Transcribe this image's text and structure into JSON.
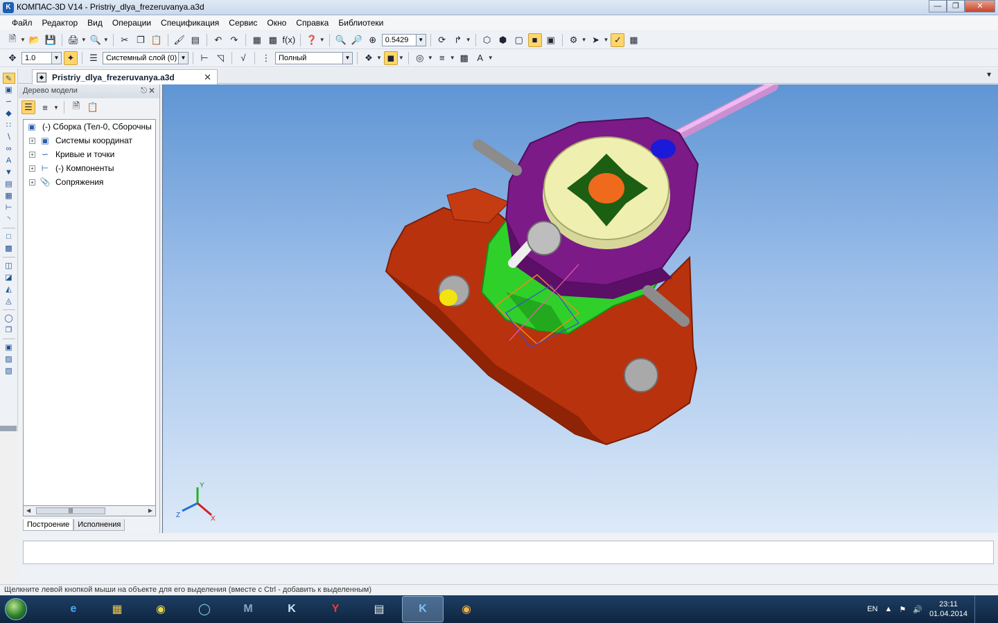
{
  "window": {
    "title": "КОМПАС-3D V14 - Pristriy_dlya_frezeruvanya.a3d"
  },
  "menu": {
    "items": [
      "Файл",
      "Редактор",
      "Вид",
      "Операции",
      "Спецификация",
      "Сервис",
      "Окно",
      "Справка",
      "Библиотеки"
    ]
  },
  "toolbar1": {
    "zoom_value": "0.5429"
  },
  "toolbar2": {
    "step_value": "1.0",
    "layer_value": "Системный слой (0)",
    "render_mode_value": "Полный"
  },
  "document": {
    "tab_name": "Pristriy_dlya_frezeruvanya.a3d"
  },
  "model_tree": {
    "title": "Дерево модели",
    "root": "(-) Сборка (Тел-0, Сборочны",
    "items": [
      {
        "label": "Системы координат",
        "icon": "coordinate-system-icon"
      },
      {
        "label": "Кривые и точки",
        "icon": "curve-icon"
      },
      {
        "label": "(-) Компоненты",
        "icon": "components-icon"
      },
      {
        "label": "Сопряжения",
        "icon": "mates-icon"
      }
    ],
    "tabs": [
      "Построение",
      "Исполнения"
    ],
    "active_tab": "Построение"
  },
  "viewport": {
    "axes": {
      "x": "X",
      "y": "Y",
      "z": "Z"
    },
    "colors": {
      "base": "#b8320e",
      "bracket": "#2fd02a",
      "clamp_plate": "#7c1a88",
      "chuck": "#efefb0",
      "rod": "#e6a3e8",
      "handle": "#8c8c8c",
      "bolt": "#bdbdbd",
      "nut_cap": "#f2e311"
    }
  },
  "status": {
    "hint": "Щелкните левой кнопкой мыши на объекте для его выделения (вместе с Ctrl - добавить к выделенным)"
  },
  "taskbar": {
    "apps": [
      "internet-explorer-icon",
      "file-explorer-icon",
      "chrome-icon",
      "app-icon",
      "mathcad-icon",
      "kompas-viewer-icon",
      "yandex-browser-icon",
      "document-icon",
      "kompas-icon",
      "paint-icon"
    ],
    "language": "EN",
    "time": "23:11",
    "date": "01.04.2014"
  }
}
